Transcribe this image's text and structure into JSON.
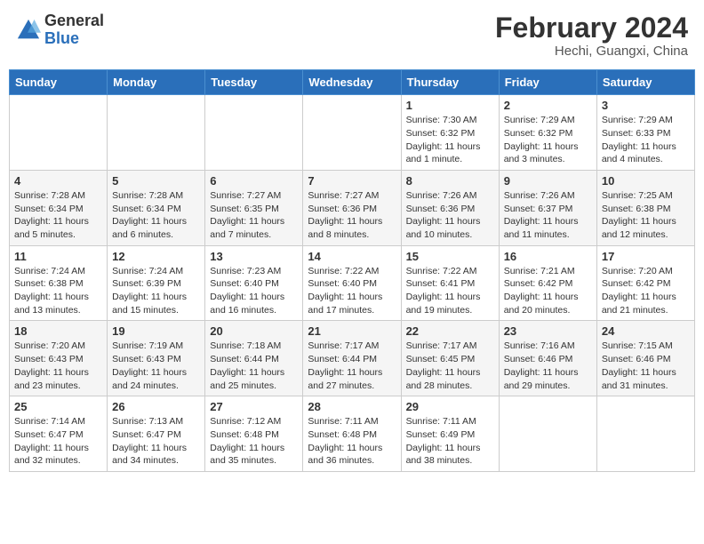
{
  "header": {
    "logo_general": "General",
    "logo_blue": "Blue",
    "main_title": "February 2024",
    "sub_title": "Hechi, Guangxi, China"
  },
  "days_of_week": [
    "Sunday",
    "Monday",
    "Tuesday",
    "Wednesday",
    "Thursday",
    "Friday",
    "Saturday"
  ],
  "weeks": [
    [
      {
        "day": "",
        "info": ""
      },
      {
        "day": "",
        "info": ""
      },
      {
        "day": "",
        "info": ""
      },
      {
        "day": "",
        "info": ""
      },
      {
        "day": "1",
        "info": "Sunrise: 7:30 AM\nSunset: 6:32 PM\nDaylight: 11 hours and 1 minute."
      },
      {
        "day": "2",
        "info": "Sunrise: 7:29 AM\nSunset: 6:32 PM\nDaylight: 11 hours and 3 minutes."
      },
      {
        "day": "3",
        "info": "Sunrise: 7:29 AM\nSunset: 6:33 PM\nDaylight: 11 hours and 4 minutes."
      }
    ],
    [
      {
        "day": "4",
        "info": "Sunrise: 7:28 AM\nSunset: 6:34 PM\nDaylight: 11 hours and 5 minutes."
      },
      {
        "day": "5",
        "info": "Sunrise: 7:28 AM\nSunset: 6:34 PM\nDaylight: 11 hours and 6 minutes."
      },
      {
        "day": "6",
        "info": "Sunrise: 7:27 AM\nSunset: 6:35 PM\nDaylight: 11 hours and 7 minutes."
      },
      {
        "day": "7",
        "info": "Sunrise: 7:27 AM\nSunset: 6:36 PM\nDaylight: 11 hours and 8 minutes."
      },
      {
        "day": "8",
        "info": "Sunrise: 7:26 AM\nSunset: 6:36 PM\nDaylight: 11 hours and 10 minutes."
      },
      {
        "day": "9",
        "info": "Sunrise: 7:26 AM\nSunset: 6:37 PM\nDaylight: 11 hours and 11 minutes."
      },
      {
        "day": "10",
        "info": "Sunrise: 7:25 AM\nSunset: 6:38 PM\nDaylight: 11 hours and 12 minutes."
      }
    ],
    [
      {
        "day": "11",
        "info": "Sunrise: 7:24 AM\nSunset: 6:38 PM\nDaylight: 11 hours and 13 minutes."
      },
      {
        "day": "12",
        "info": "Sunrise: 7:24 AM\nSunset: 6:39 PM\nDaylight: 11 hours and 15 minutes."
      },
      {
        "day": "13",
        "info": "Sunrise: 7:23 AM\nSunset: 6:40 PM\nDaylight: 11 hours and 16 minutes."
      },
      {
        "day": "14",
        "info": "Sunrise: 7:22 AM\nSunset: 6:40 PM\nDaylight: 11 hours and 17 minutes."
      },
      {
        "day": "15",
        "info": "Sunrise: 7:22 AM\nSunset: 6:41 PM\nDaylight: 11 hours and 19 minutes."
      },
      {
        "day": "16",
        "info": "Sunrise: 7:21 AM\nSunset: 6:42 PM\nDaylight: 11 hours and 20 minutes."
      },
      {
        "day": "17",
        "info": "Sunrise: 7:20 AM\nSunset: 6:42 PM\nDaylight: 11 hours and 21 minutes."
      }
    ],
    [
      {
        "day": "18",
        "info": "Sunrise: 7:20 AM\nSunset: 6:43 PM\nDaylight: 11 hours and 23 minutes."
      },
      {
        "day": "19",
        "info": "Sunrise: 7:19 AM\nSunset: 6:43 PM\nDaylight: 11 hours and 24 minutes."
      },
      {
        "day": "20",
        "info": "Sunrise: 7:18 AM\nSunset: 6:44 PM\nDaylight: 11 hours and 25 minutes."
      },
      {
        "day": "21",
        "info": "Sunrise: 7:17 AM\nSunset: 6:44 PM\nDaylight: 11 hours and 27 minutes."
      },
      {
        "day": "22",
        "info": "Sunrise: 7:17 AM\nSunset: 6:45 PM\nDaylight: 11 hours and 28 minutes."
      },
      {
        "day": "23",
        "info": "Sunrise: 7:16 AM\nSunset: 6:46 PM\nDaylight: 11 hours and 29 minutes."
      },
      {
        "day": "24",
        "info": "Sunrise: 7:15 AM\nSunset: 6:46 PM\nDaylight: 11 hours and 31 minutes."
      }
    ],
    [
      {
        "day": "25",
        "info": "Sunrise: 7:14 AM\nSunset: 6:47 PM\nDaylight: 11 hours and 32 minutes."
      },
      {
        "day": "26",
        "info": "Sunrise: 7:13 AM\nSunset: 6:47 PM\nDaylight: 11 hours and 34 minutes."
      },
      {
        "day": "27",
        "info": "Sunrise: 7:12 AM\nSunset: 6:48 PM\nDaylight: 11 hours and 35 minutes."
      },
      {
        "day": "28",
        "info": "Sunrise: 7:11 AM\nSunset: 6:48 PM\nDaylight: 11 hours and 36 minutes."
      },
      {
        "day": "29",
        "info": "Sunrise: 7:11 AM\nSunset: 6:49 PM\nDaylight: 11 hours and 38 minutes."
      },
      {
        "day": "",
        "info": ""
      },
      {
        "day": "",
        "info": ""
      }
    ]
  ]
}
